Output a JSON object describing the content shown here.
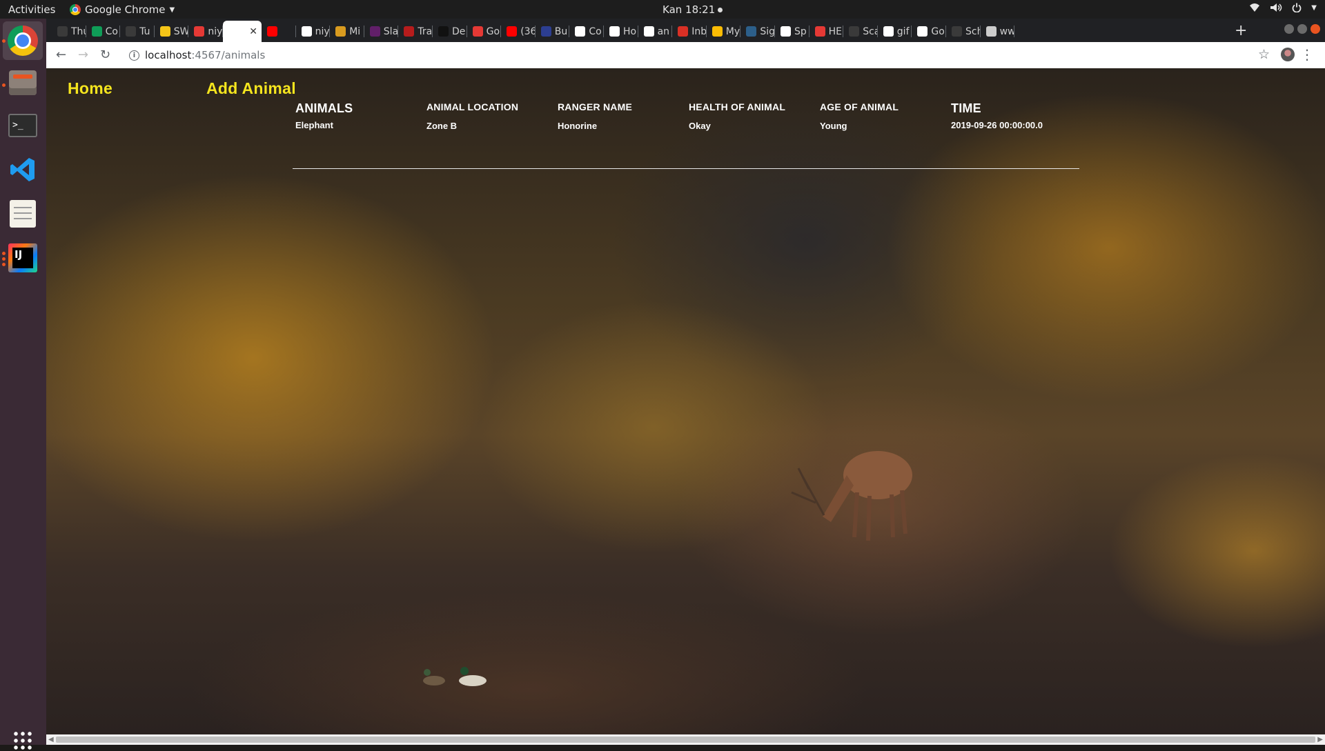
{
  "system": {
    "activities": "Activities",
    "app_name": "Google Chrome",
    "clock": "Kan 18:21"
  },
  "dock": {
    "items": [
      "chrome",
      "files",
      "terminal",
      "vscode",
      "text-editor",
      "intellij-idea",
      "show-applications"
    ]
  },
  "browser": {
    "tabs": [
      {
        "label": "Thu",
        "color": "#3a3a3a"
      },
      {
        "label": "Co",
        "color": "#0f9d58"
      },
      {
        "label": "Tu",
        "color": "#3a3a3a"
      },
      {
        "label": "SW",
        "color": "#f5c518"
      },
      {
        "label": "niy",
        "color": "#e53935"
      },
      {
        "label": "",
        "color": "#ffffff",
        "active": true
      },
      {
        "label": "",
        "color": "#ff0000"
      },
      {
        "label": "niy",
        "color": "#ffffff"
      },
      {
        "label": "Mi",
        "color": "#d99b1f"
      },
      {
        "label": "Sla",
        "color": "#611f69"
      },
      {
        "label": "Tra",
        "color": "#b71c1c"
      },
      {
        "label": "De",
        "color": "#111111"
      },
      {
        "label": "Go",
        "color": "#e53935"
      },
      {
        "label": "(36",
        "color": "#ff0000"
      },
      {
        "label": "Bu",
        "color": "#2c3e91"
      },
      {
        "label": "Co",
        "color": "#ffffff"
      },
      {
        "label": "Ho",
        "color": "#ffffff"
      },
      {
        "label": "an",
        "color": "#ffffff"
      },
      {
        "label": "Inb",
        "color": "#d93025"
      },
      {
        "label": "My",
        "color": "#fbbc04"
      },
      {
        "label": "Sig",
        "color": "#2c5f8a"
      },
      {
        "label": "Sp",
        "color": "#ffffff"
      },
      {
        "label": "HE",
        "color": "#e53935"
      },
      {
        "label": "Sca",
        "color": "#3a3a3a"
      },
      {
        "label": "gif",
        "color": "#ffffff"
      },
      {
        "label": "Go",
        "color": "#ffffff"
      },
      {
        "label": "Sch",
        "color": "#3a3a3a"
      },
      {
        "label": "ww",
        "color": "#cccccc"
      }
    ],
    "active_tab_close": "✕",
    "url_host": "localhost",
    "url_path": ":4567/animals"
  },
  "page": {
    "nav": {
      "home": "Home",
      "add": "Add Animal"
    },
    "columns": [
      {
        "header": "ANIMALS",
        "value": "Elephant"
      },
      {
        "header": "ANIMAL LOCATION",
        "value": "Zone B"
      },
      {
        "header": "RANGER NAME",
        "value": "Honorine"
      },
      {
        "header": "HEALTH OF ANIMAL",
        "value": "Okay"
      },
      {
        "header": "AGE OF ANIMAL",
        "value": "Young"
      },
      {
        "header": "TIME",
        "value": "2019-09-26 00:00:00.0"
      }
    ]
  }
}
